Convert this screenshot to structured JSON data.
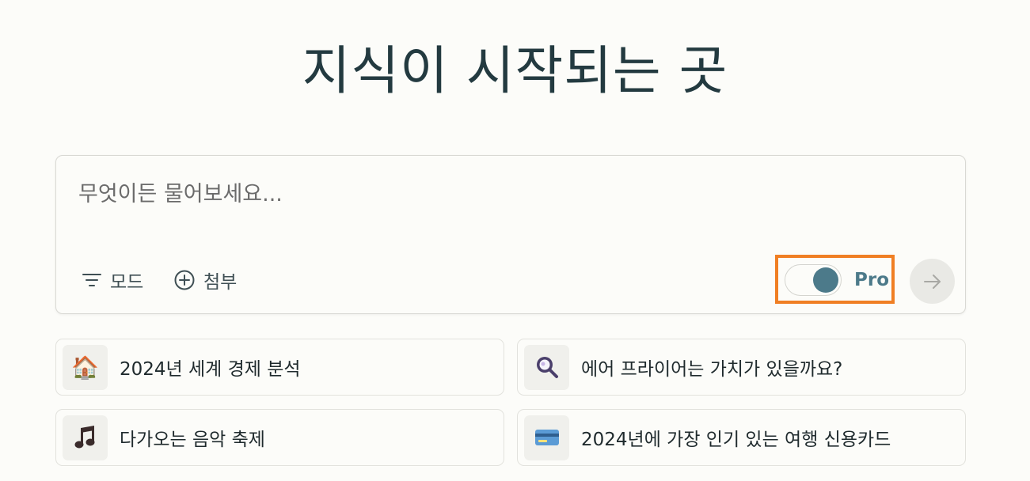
{
  "headline": "지식이 시작되는 곳",
  "ask": {
    "placeholder": "무엇이든 물어보세요...",
    "value": "",
    "mode_label": "모드",
    "attach_label": "첨부",
    "pro_label": "Pro",
    "pro_enabled": true
  },
  "suggestions": [
    {
      "icon": "house-icon",
      "glyph": "🏠",
      "text": "2024년 세계 경제 분석"
    },
    {
      "icon": "magnifier-icon",
      "glyph": "",
      "text": "에어 프라이어는 가치가 있을까요?"
    },
    {
      "icon": "music-note-icon",
      "glyph": "🎵",
      "text": "다가오는 음악 축제"
    },
    {
      "icon": "credit-card-icon",
      "glyph": "",
      "text": "2024년에 가장 인기 있는 여행 신용카드"
    }
  ],
  "colors": {
    "background": "#fcfcf9",
    "accent_teal": "#4c7a8a",
    "highlight_orange": "#f07f24",
    "text_dark": "#13343b"
  }
}
